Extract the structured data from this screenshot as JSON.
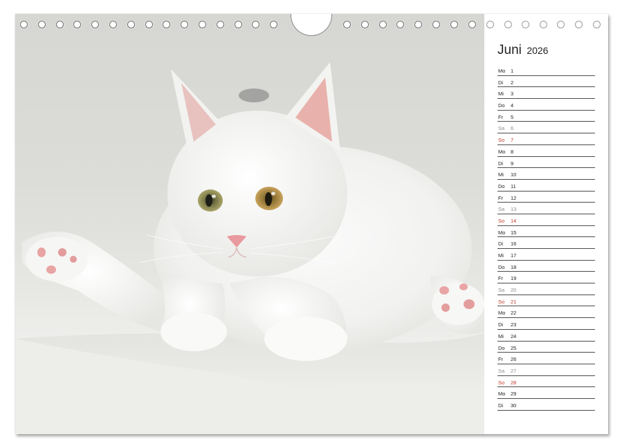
{
  "calendar": {
    "month": "Juni",
    "year": "2026",
    "days": [
      {
        "weekday": "Mo",
        "date": "1",
        "type": "weekday"
      },
      {
        "weekday": "Di",
        "date": "2",
        "type": "weekday"
      },
      {
        "weekday": "Mi",
        "date": "3",
        "type": "weekday"
      },
      {
        "weekday": "Do",
        "date": "4",
        "type": "weekday"
      },
      {
        "weekday": "Fr",
        "date": "5",
        "type": "weekday"
      },
      {
        "weekday": "Sa",
        "date": "6",
        "type": "saturday"
      },
      {
        "weekday": "So",
        "date": "7",
        "type": "sunday"
      },
      {
        "weekday": "Mo",
        "date": "8",
        "type": "weekday"
      },
      {
        "weekday": "Di",
        "date": "9",
        "type": "weekday"
      },
      {
        "weekday": "Mi",
        "date": "10",
        "type": "weekday"
      },
      {
        "weekday": "Do",
        "date": "11",
        "type": "weekday"
      },
      {
        "weekday": "Fr",
        "date": "12",
        "type": "weekday"
      },
      {
        "weekday": "Sa",
        "date": "13",
        "type": "saturday"
      },
      {
        "weekday": "So",
        "date": "14",
        "type": "sunday"
      },
      {
        "weekday": "Mo",
        "date": "15",
        "type": "weekday"
      },
      {
        "weekday": "Di",
        "date": "16",
        "type": "weekday"
      },
      {
        "weekday": "Mi",
        "date": "17",
        "type": "weekday"
      },
      {
        "weekday": "Do",
        "date": "18",
        "type": "weekday"
      },
      {
        "weekday": "Fr",
        "date": "19",
        "type": "weekday"
      },
      {
        "weekday": "Sa",
        "date": "20",
        "type": "saturday"
      },
      {
        "weekday": "So",
        "date": "21",
        "type": "sunday"
      },
      {
        "weekday": "Mo",
        "date": "22",
        "type": "weekday"
      },
      {
        "weekday": "Di",
        "date": "23",
        "type": "weekday"
      },
      {
        "weekday": "Mi",
        "date": "24",
        "type": "weekday"
      },
      {
        "weekday": "Do",
        "date": "25",
        "type": "weekday"
      },
      {
        "weekday": "Fr",
        "date": "26",
        "type": "weekday"
      },
      {
        "weekday": "Sa",
        "date": "27",
        "type": "saturday"
      },
      {
        "weekday": "So",
        "date": "28",
        "type": "sunday"
      },
      {
        "weekday": "Mo",
        "date": "29",
        "type": "weekday"
      },
      {
        "weekday": "Di",
        "date": "30",
        "type": "weekday"
      }
    ]
  },
  "colors": {
    "sunday": "#c0392b",
    "saturday": "#8a8a8a",
    "rule_line": "#4a4a4a"
  },
  "photo": {
    "subject_icon": "white-kitten-photo"
  }
}
